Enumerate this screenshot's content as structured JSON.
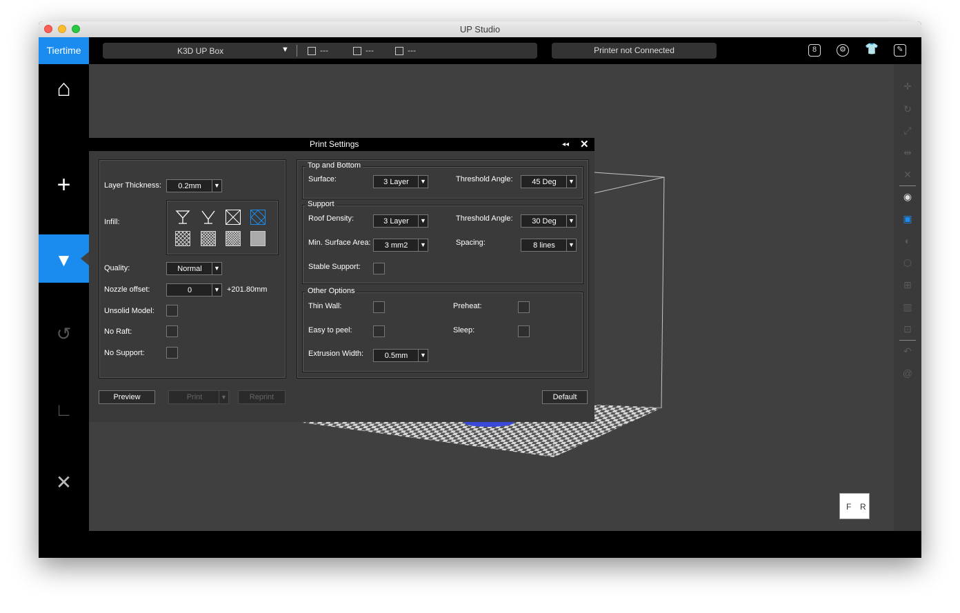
{
  "window": {
    "title": "UP Studio"
  },
  "topbar": {
    "logo": "Tiertime",
    "printer_name": "K3D UP Box",
    "nozzle_temp": "---",
    "bed_temp": "---",
    "material": "---",
    "status": "Printer not Connected",
    "icons": [
      "account-icon",
      "settings-icon",
      "shirt-icon",
      "clipboard-icon"
    ]
  },
  "left_nav": {
    "items": [
      "home",
      "add",
      "print",
      "calibrate",
      "measure",
      "tools"
    ],
    "active": "print"
  },
  "dialog": {
    "title": "Print Settings",
    "left": {
      "layer_thickness_label": "Layer Thickness:",
      "layer_thickness_value": "0.2mm",
      "infill_label": "Infill:",
      "infill_selected_index": 3,
      "quality_label": "Quality:",
      "quality_value": "Normal",
      "nozzle_offset_label": "Nozzle offset:",
      "nozzle_offset_value": "0",
      "nozzle_offset_extra": "+201.80mm",
      "unsolid_model_label": "Unsolid Model:",
      "no_raft_label": "No Raft:",
      "no_support_label": "No Support:"
    },
    "top_bottom": {
      "legend": "Top and Bottom",
      "surface_label": "Surface:",
      "surface_value": "3 Layer",
      "threshold_label": "Threshold Angle:",
      "threshold_value": "45 Deg"
    },
    "support": {
      "legend": "Support",
      "roof_density_label": "Roof Density:",
      "roof_density_value": "3 Layer",
      "threshold_label": "Threshold Angle:",
      "threshold_value": "30 Deg",
      "min_surface_label": "Min. Surface Area:",
      "min_surface_value": "3 mm2",
      "spacing_label": "Spacing:",
      "spacing_value": "8 lines",
      "stable_support_label": "Stable Support:"
    },
    "other": {
      "legend": "Other Options",
      "thin_wall_label": "Thin Wall:",
      "preheat_label": "Preheat:",
      "easy_peel_label": "Easy to peel:",
      "sleep_label": "Sleep:",
      "extrusion_width_label": "Extrusion Width:",
      "extrusion_width_value": "0.5mm"
    },
    "buttons": {
      "preview": "Preview",
      "print": "Print",
      "reprint": "Reprint",
      "default": "Default"
    }
  },
  "viewcube": {
    "front": "F",
    "right": "R"
  }
}
